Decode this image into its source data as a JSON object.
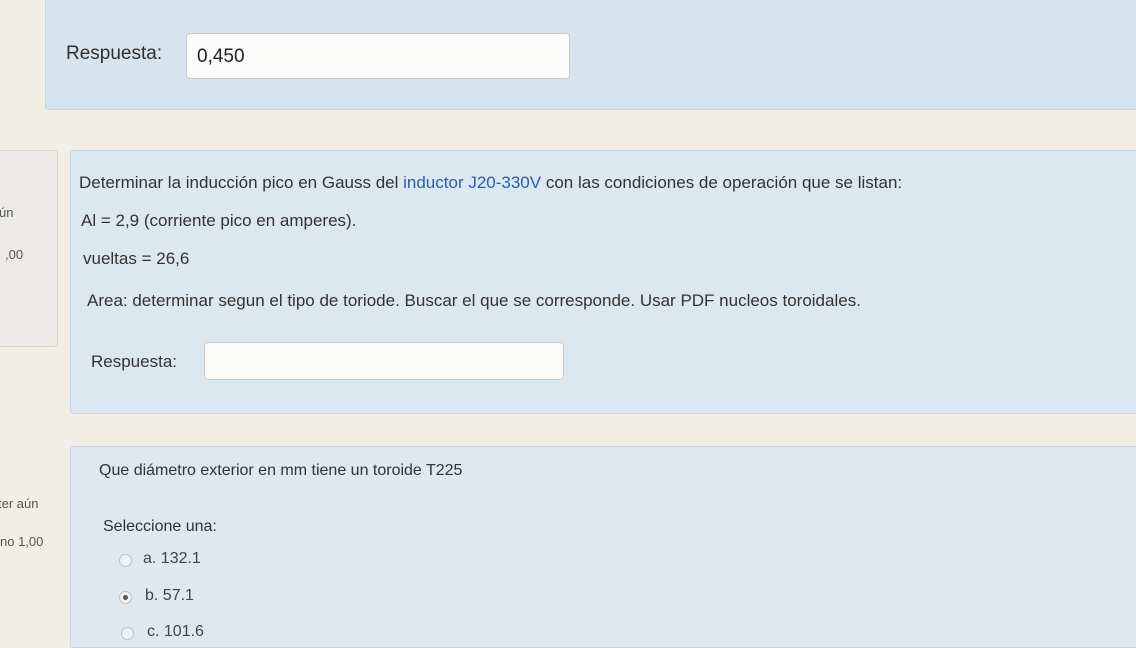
{
  "q1": {
    "answer_label": "Respuesta:",
    "answer_value": "0,450"
  },
  "q2": {
    "side": {
      "status": "ún",
      "grade": ",00"
    },
    "intro_pre": "Determinar la inducción pico en Gauss del ",
    "intro_link": "inductor J20-330V",
    "intro_post": " con las condiciones de operación que se listan:",
    "line_al": "Al = 2,9 (corriente pico en amperes).",
    "line_vueltas": "vueltas = 26,6",
    "line_area": "Area: determinar segun el tipo de toriode. Buscar el que se corresponde. Usar PDF nucleos toroidales.",
    "answer_label": "Respuesta:",
    "answer_value": ""
  },
  "q3": {
    "side": {
      "status": "ter aún",
      "grade": "no 1,00"
    },
    "question": "Que diámetro exterior en mm tiene un toroide T225",
    "prompt": "Seleccione una:",
    "options": [
      {
        "label": "a. 132.1",
        "selected": false
      },
      {
        "label": "b. 57.1",
        "selected": true
      },
      {
        "label": "c. 101.6",
        "selected": false
      }
    ]
  }
}
